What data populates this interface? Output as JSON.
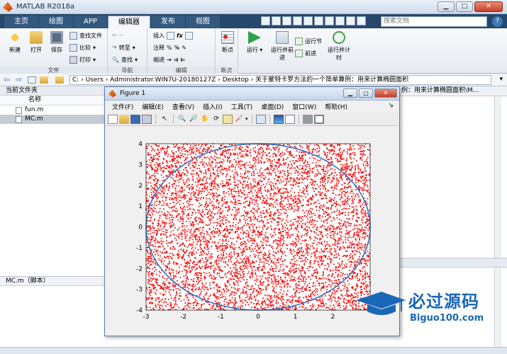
{
  "app": {
    "title": "MATLAB R2018a"
  },
  "tabs": [
    "主页",
    "绘图",
    "APP",
    "编辑器",
    "发布",
    "视图"
  ],
  "search": {
    "placeholder": "搜索文档"
  },
  "ribbon": {
    "file_group": {
      "label": "文件",
      "new": "新建",
      "open": "打开",
      "save": "保存",
      "find_files": "查找文件",
      "compare": "比较",
      "print": "打印"
    },
    "nav_group": {
      "label": "导航",
      "goto": "转至",
      "find": "查找"
    },
    "edit_group": {
      "label": "编辑",
      "insert": "插入",
      "comment": "注释",
      "indent": "缩进"
    },
    "breakpoint_group": {
      "label": "断点",
      "breakpoints": "断点"
    },
    "run_group": {
      "run": "运行",
      "run_advance": "运行并前进",
      "run_section": "运行节",
      "advance": "前进",
      "run_time": "运行并计时"
    }
  },
  "address": {
    "path": "C: › Users › Administrator.WIN7U-20180127Z › Desktop › 关于蒙特卡罗方法的一个简单算例：用来计算椭圆面积"
  },
  "current_folder": {
    "header": "当前文件夹",
    "column": "名称",
    "files": [
      "fun.m",
      "MC.m"
    ],
    "details": "MC.m（脚本）"
  },
  "command_header": "例：用来计算椭圆面积\\M...",
  "figure": {
    "title": "Figure 1",
    "menu": [
      "文件(F)",
      "编辑(E)",
      "查看(V)",
      "插入(I)",
      "工具(T)",
      "桌面(D)",
      "窗口(W)",
      "帮助(H)"
    ]
  },
  "chart_data": {
    "type": "scatter",
    "title": "",
    "xlabel": "",
    "ylabel": "",
    "xlim": [
      -3,
      3
    ],
    "ylim": [
      -4,
      4
    ],
    "xticks": [
      -3,
      -2,
      -1,
      0,
      1,
      2
    ],
    "yticks": [
      4,
      3,
      2,
      1,
      0,
      -1,
      -2,
      -3,
      -4
    ],
    "series": [
      {
        "kind": "points",
        "color": "#ff0000",
        "distribution": "uniform",
        "x_range": [
          -3,
          3
        ],
        "y_range": [
          -4,
          4
        ],
        "count": 10000
      },
      {
        "kind": "ellipse",
        "color": "#2b78c9",
        "a": 3,
        "b": 4
      }
    ],
    "grid": false
  },
  "watermark": {
    "text": "必过源码",
    "url": "Biguo100.com"
  },
  "colors": {
    "tab_bar": "#26486d",
    "point": "#ff0000",
    "ellipse": "#2b78c9",
    "watermark": "#1a67b8"
  }
}
